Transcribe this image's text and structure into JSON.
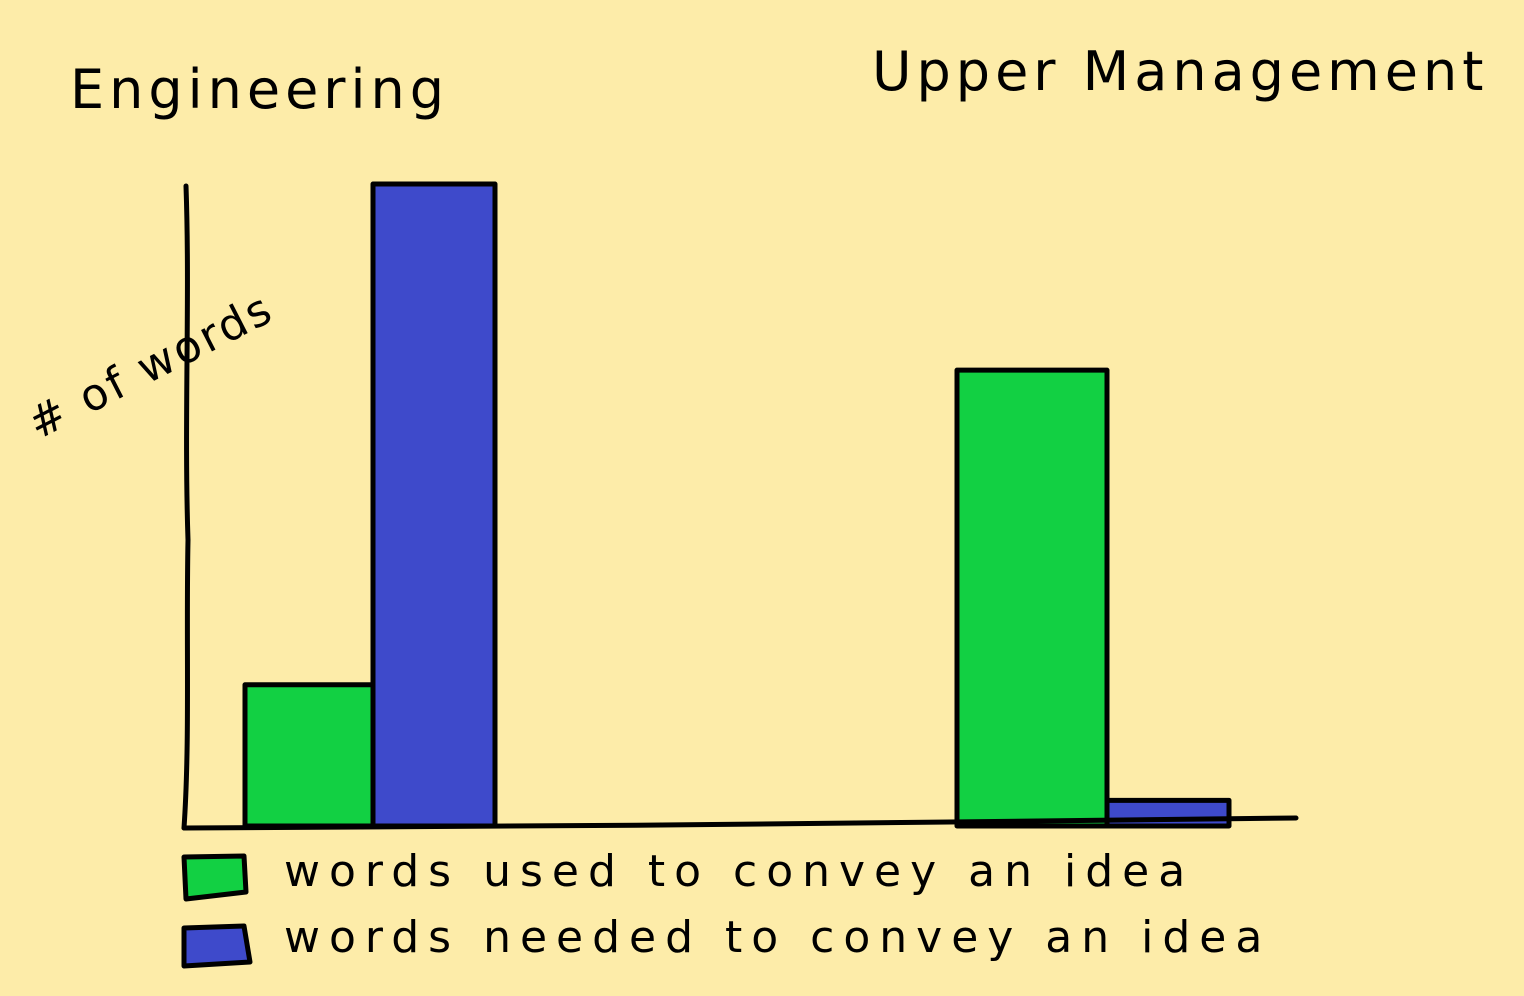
{
  "chart_data": {
    "type": "bar",
    "categories": [
      "Engineering",
      "Upper Management"
    ],
    "ylabel": "# of words",
    "ylim": [
      0,
      100
    ],
    "grid": false,
    "legend_position": "bottom",
    "series": [
      {
        "name": "words used to convey an idea",
        "color": "#12D043",
        "values": [
          22,
          71
        ]
      },
      {
        "name": "words needed to convey an idea",
        "color": "#3E4ACB",
        "values": [
          100,
          4
        ]
      }
    ]
  }
}
